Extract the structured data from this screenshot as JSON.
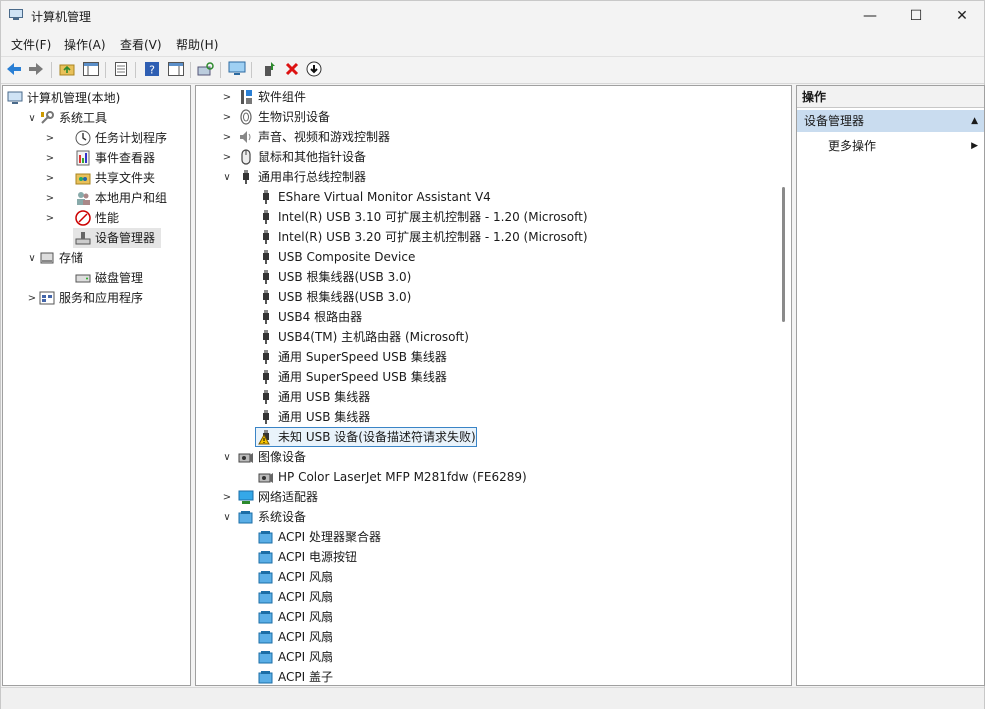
{
  "window": {
    "title": "计算机管理",
    "minimize": "—",
    "maximize": "☐",
    "close": "✕"
  },
  "menu": [
    "文件(F)",
    "操作(A)",
    "查看(V)",
    "帮助(H)"
  ],
  "toolbar": {
    "buttons": [
      "back-icon",
      "forward-icon",
      "up-folder-icon",
      "show-tree-icon",
      "properties-icon",
      "help-icon",
      "show-action-pane-icon",
      "scan-hardware-icon",
      "monitor-icon",
      "update-driver-icon",
      "uninstall-icon",
      "disable-icon"
    ]
  },
  "left_tree": [
    {
      "label": "计算机管理(本地)",
      "indent": 0,
      "chev": "",
      "icon": "computer-management-icon"
    },
    {
      "label": "系统工具",
      "indent": 1,
      "chev": "∨",
      "icon": "system-tools-icon"
    },
    {
      "label": "任务计划程序",
      "indent": 2,
      "chev": ">",
      "icon": "task-scheduler-icon"
    },
    {
      "label": "事件查看器",
      "indent": 2,
      "chev": ">",
      "icon": "event-viewer-icon"
    },
    {
      "label": "共享文件夹",
      "indent": 2,
      "chev": ">",
      "icon": "shared-folders-icon"
    },
    {
      "label": "本地用户和组",
      "indent": 2,
      "chev": ">",
      "icon": "local-users-icon"
    },
    {
      "label": "性能",
      "indent": 2,
      "chev": ">",
      "icon": "performance-icon"
    },
    {
      "label": "设备管理器",
      "indent": 2,
      "chev": "",
      "icon": "device-manager-icon",
      "selected": true
    },
    {
      "label": "存储",
      "indent": 1,
      "chev": "∨",
      "icon": "storage-icon"
    },
    {
      "label": "磁盘管理",
      "indent": 2,
      "chev": "",
      "icon": "disk-management-icon"
    },
    {
      "label": "服务和应用程序",
      "indent": 1,
      "chev": ">",
      "icon": "services-apps-icon"
    }
  ],
  "device_tree": [
    {
      "label": "软件组件",
      "level": 0,
      "chev": ">",
      "icon": "software-component-icon"
    },
    {
      "label": "生物识别设备",
      "level": 0,
      "chev": ">",
      "icon": "biometric-icon"
    },
    {
      "label": "声音、视频和游戏控制器",
      "level": 0,
      "chev": ">",
      "icon": "sound-icon"
    },
    {
      "label": "鼠标和其他指针设备",
      "level": 0,
      "chev": ">",
      "icon": "mouse-icon"
    },
    {
      "label": "通用串行总线控制器",
      "level": 0,
      "chev": "∨",
      "icon": "usb-icon"
    },
    {
      "label": "EShare Virtual Monitor Assistant V4",
      "level": 1,
      "icon": "usb-icon"
    },
    {
      "label": "Intel(R) USB 3.10 可扩展主机控制器 - 1.20 (Microsoft)",
      "level": 1,
      "icon": "usb-icon"
    },
    {
      "label": "Intel(R) USB 3.20 可扩展主机控制器 - 1.20 (Microsoft)",
      "level": 1,
      "icon": "usb-icon"
    },
    {
      "label": "USB Composite Device",
      "level": 1,
      "icon": "usb-icon"
    },
    {
      "label": "USB 根集线器(USB 3.0)",
      "level": 1,
      "icon": "usb-icon"
    },
    {
      "label": "USB 根集线器(USB 3.0)",
      "level": 1,
      "icon": "usb-icon"
    },
    {
      "label": "USB4 根路由器",
      "level": 1,
      "icon": "usb-icon"
    },
    {
      "label": "USB4(TM) 主机路由器 (Microsoft)",
      "level": 1,
      "icon": "usb-icon"
    },
    {
      "label": "通用 SuperSpeed USB 集线器",
      "level": 1,
      "icon": "usb-icon"
    },
    {
      "label": "通用 SuperSpeed USB 集线器",
      "level": 1,
      "icon": "usb-icon"
    },
    {
      "label": "通用 USB 集线器",
      "level": 1,
      "icon": "usb-icon"
    },
    {
      "label": "通用 USB 集线器",
      "level": 1,
      "icon": "usb-icon"
    },
    {
      "label": "未知 USB 设备(设备描述符请求失败)",
      "level": 1,
      "icon": "warning-icon",
      "selected": true
    },
    {
      "label": "图像设备",
      "level": 0,
      "chev": "∨",
      "icon": "camera-icon"
    },
    {
      "label": "HP Color LaserJet MFP M281fdw (FE6289)",
      "level": 1,
      "icon": "camera-icon"
    },
    {
      "label": "网络适配器",
      "level": 0,
      "chev": ">",
      "icon": "network-adapter-icon"
    },
    {
      "label": "系统设备",
      "level": 0,
      "chev": "∨",
      "icon": "system-device-icon"
    },
    {
      "label": "ACPI 处理器聚合器",
      "level": 1,
      "icon": "system-device-icon"
    },
    {
      "label": "ACPI 电源按钮",
      "level": 1,
      "icon": "system-device-icon"
    },
    {
      "label": "ACPI 风扇",
      "level": 1,
      "icon": "system-device-icon"
    },
    {
      "label": "ACPI 风扇",
      "level": 1,
      "icon": "system-device-icon"
    },
    {
      "label": "ACPI 风扇",
      "level": 1,
      "icon": "system-device-icon"
    },
    {
      "label": "ACPI 风扇",
      "level": 1,
      "icon": "system-device-icon"
    },
    {
      "label": "ACPI 风扇",
      "level": 1,
      "icon": "system-device-icon"
    },
    {
      "label": "ACPI 盖子",
      "level": 1,
      "icon": "system-device-icon"
    }
  ],
  "actions": {
    "header": "操作",
    "section": "设备管理器",
    "more": "更多操作"
  },
  "colors": {
    "selection_border": "#3a84c6",
    "selection_fill": "#e9f3fb",
    "section_bg": "#c9dcef"
  }
}
